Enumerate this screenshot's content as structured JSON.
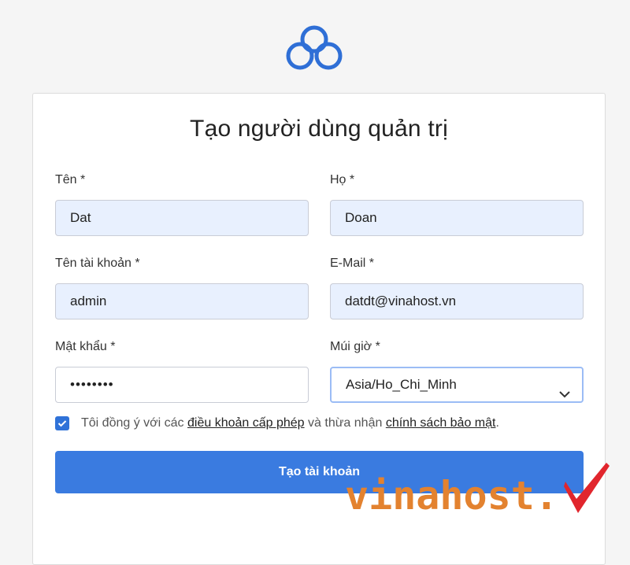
{
  "title": "Tạo người dùng quản trị",
  "fields": {
    "first_name": {
      "label": "Tên *",
      "value": "Dat"
    },
    "last_name": {
      "label": "Họ *",
      "value": "Doan"
    },
    "username": {
      "label": "Tên tài khoản *",
      "value": "admin"
    },
    "email": {
      "label": "E-Mail *",
      "value": "datdt@vinahost.vn"
    },
    "password": {
      "label": "Mật khẩu *",
      "value": "••••••••"
    },
    "timezone": {
      "label": "Múi giờ *",
      "value": "Asia/Ho_Chi_Minh"
    }
  },
  "consent": {
    "checked": true,
    "prefix": "Tôi đồng ý với các",
    "terms_link": "điều khoản cấp phép",
    "middle": "và thừa nhận",
    "privacy_link": "chính sách bảo mật",
    "suffix": "."
  },
  "submit_label": "Tạo tài khoản",
  "watermark": "vinahost.",
  "colors": {
    "accent": "#3a7be0",
    "logo": "#2f6fd6",
    "watermark": "#e3822f",
    "watermark_check": "#e1262d"
  },
  "icons": {
    "logo": "cloud-logo-icon",
    "checkbox": "check-icon",
    "select": "chevron-down-icon"
  }
}
